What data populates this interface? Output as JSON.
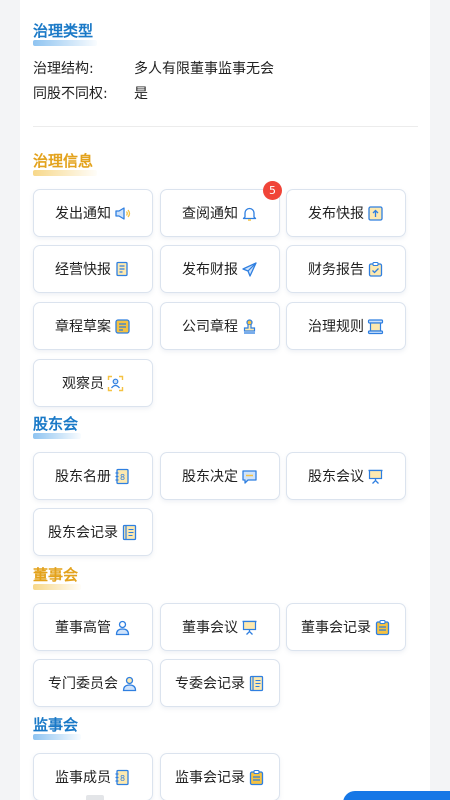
{
  "top_cut_text": "",
  "governance_type": {
    "title": "治理类型",
    "rows": [
      {
        "label": "治理结构:",
        "value": "多人有限董事监事无会"
      },
      {
        "label": "同股不同权:",
        "value": "是"
      }
    ]
  },
  "governance_info": {
    "title": "治理信息",
    "buttons": [
      {
        "label": "发出通知",
        "icon": "megaphone-icon"
      },
      {
        "label": "查阅通知",
        "icon": "bell-icon",
        "badge": "5"
      },
      {
        "label": "发布快报",
        "icon": "upload-doc-icon"
      },
      {
        "label": "经营快报",
        "icon": "document-icon"
      },
      {
        "label": "发布财报",
        "icon": "paper-plane-icon"
      },
      {
        "label": "财务报告",
        "icon": "clipboard-check-icon"
      },
      {
        "label": "章程草案",
        "icon": "notepad-icon"
      },
      {
        "label": "公司章程",
        "icon": "stamp-icon"
      },
      {
        "label": "治理规则",
        "icon": "scroll-icon"
      },
      {
        "label": "观察员",
        "icon": "observer-icon"
      }
    ]
  },
  "shareholders": {
    "title": "股东会",
    "buttons": [
      {
        "label": "股东名册",
        "icon": "roster-icon"
      },
      {
        "label": "股东决定",
        "icon": "chat-icon"
      },
      {
        "label": "股东会议",
        "icon": "presentation-icon"
      },
      {
        "label": "股东会记录",
        "icon": "record-book-icon"
      }
    ]
  },
  "board": {
    "title": "董事会",
    "buttons": [
      {
        "label": "董事高管",
        "icon": "person-icon"
      },
      {
        "label": "董事会议",
        "icon": "presentation-icon"
      },
      {
        "label": "董事会记录",
        "icon": "clipboard-icon"
      },
      {
        "label": "专门委员会",
        "icon": "person-icon"
      },
      {
        "label": "专委会记录",
        "icon": "record-book-icon"
      }
    ]
  },
  "supervisors": {
    "title": "监事会",
    "buttons": [
      {
        "label": "监事成员",
        "icon": "roster-icon"
      },
      {
        "label": "监事会记录",
        "icon": "clipboard-icon"
      }
    ]
  },
  "colors": {
    "accent_blue": "#1a79c7",
    "accent_gold": "#e3a21c",
    "badge_red": "#f04438",
    "icon_blue": "#2f7fe0",
    "icon_yellow": "#f5c242"
  }
}
